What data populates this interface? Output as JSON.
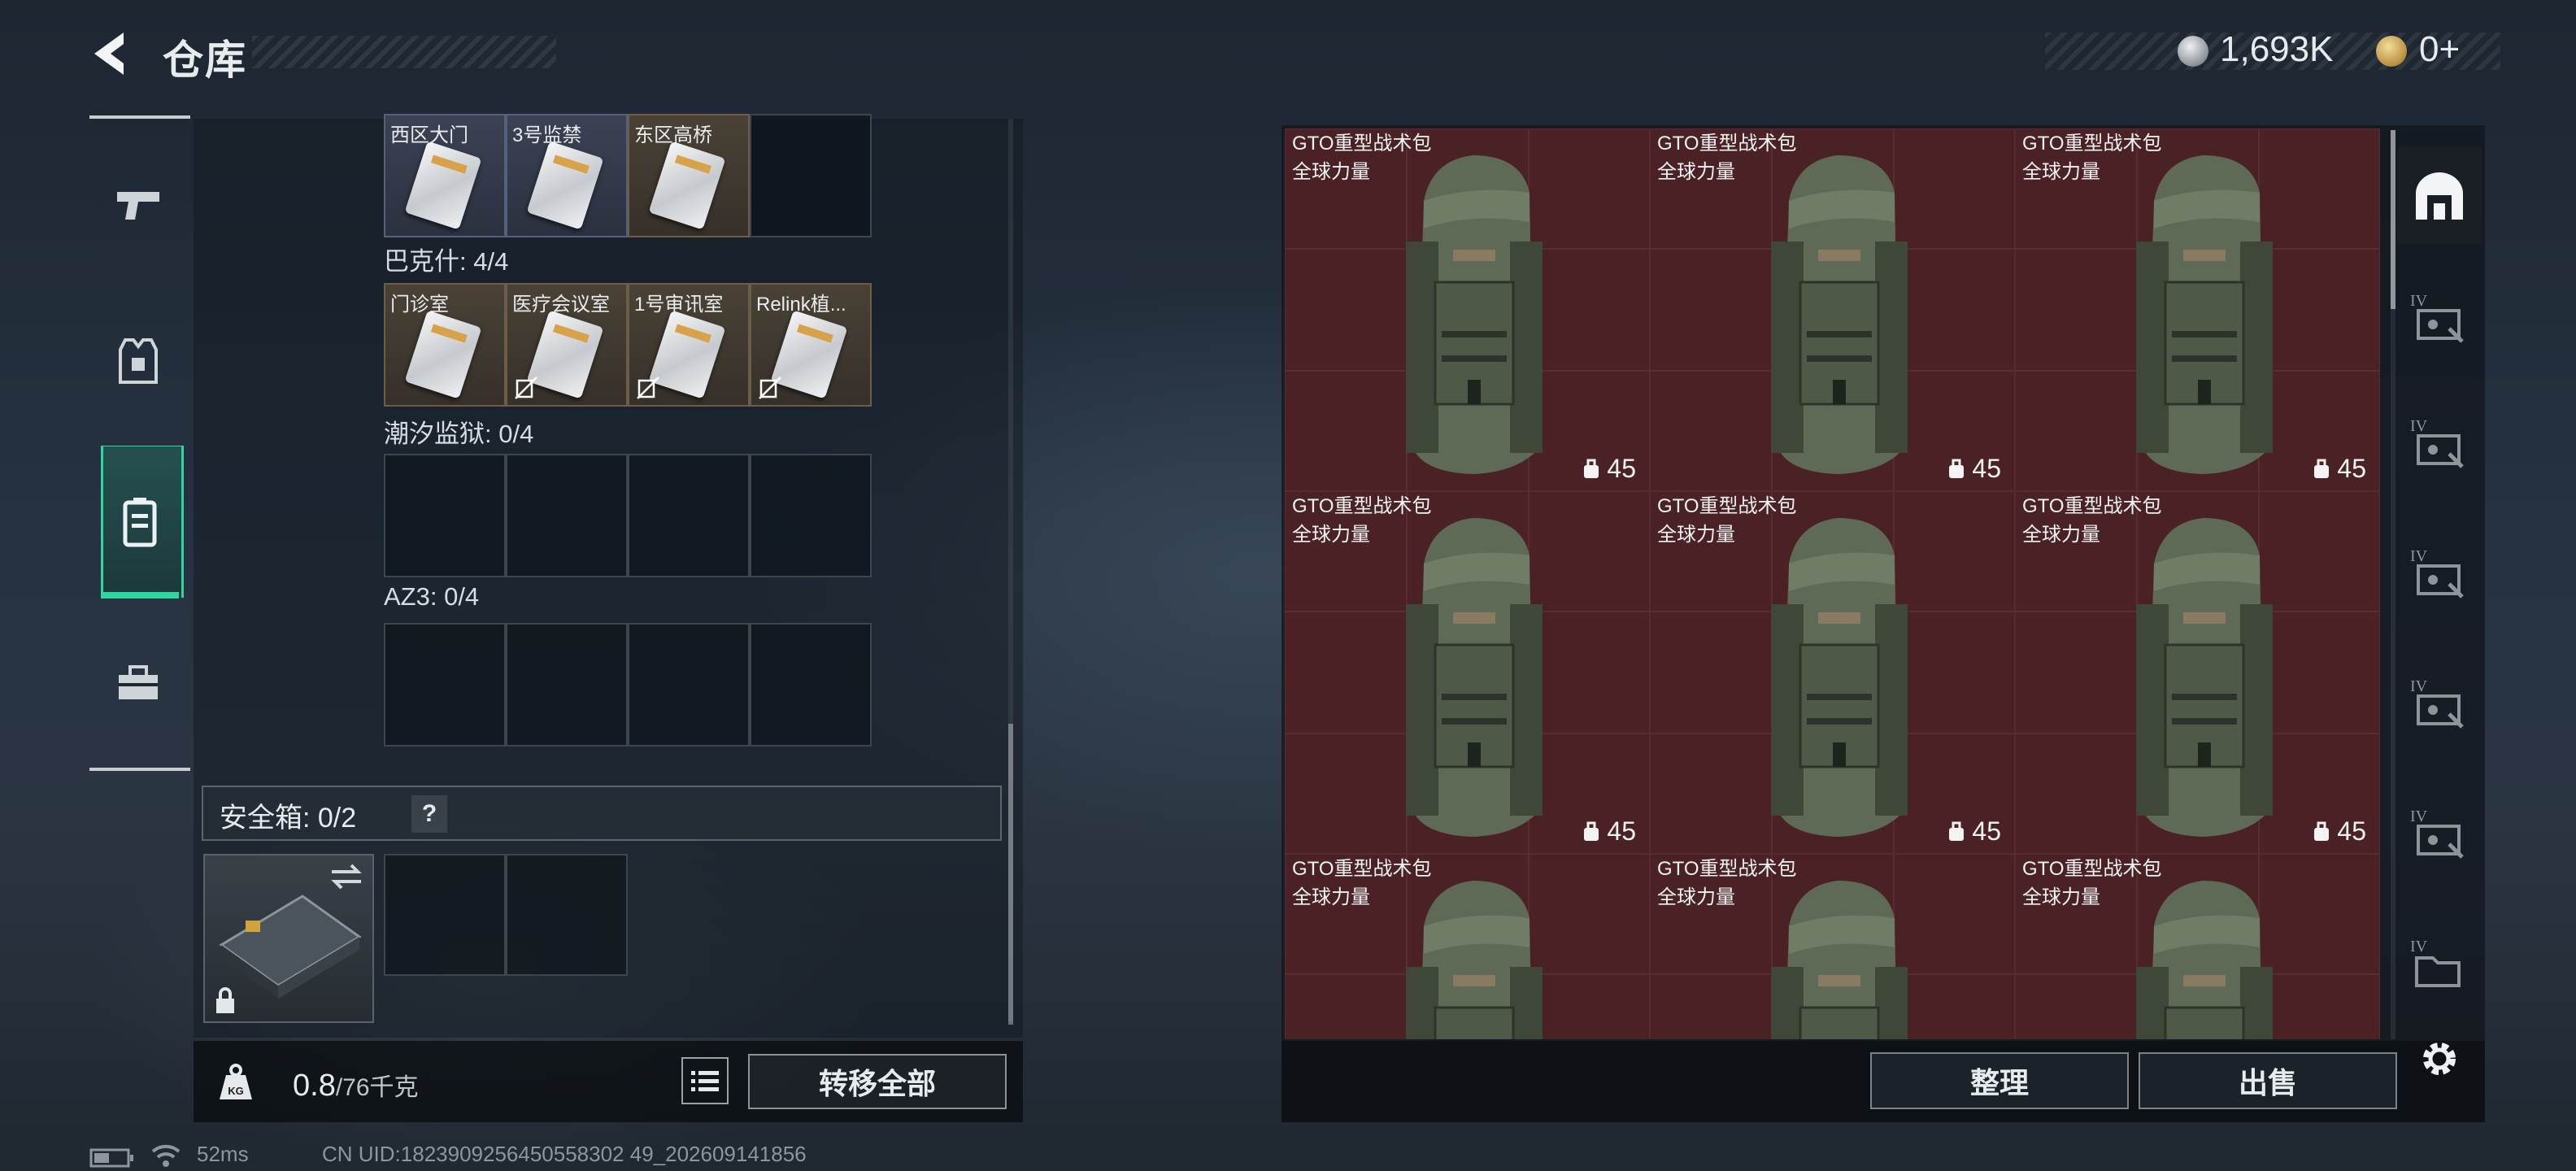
{
  "header": {
    "title": "仓库"
  },
  "currency": {
    "silver": "1,693K",
    "gold": "0+"
  },
  "nav": {
    "items": [
      "weapon",
      "gear",
      "backpack",
      "toolbox"
    ],
    "active": "backpack"
  },
  "key_sections": [
    {
      "label": "",
      "slots": [
        "西区大门",
        "3号监禁",
        "东区高桥",
        ""
      ]
    },
    {
      "label": "巴克什: 4/4",
      "slots": [
        "门诊室",
        "医疗会议室",
        "1号审讯室",
        "Relink植..."
      ]
    },
    {
      "label": "潮汐监狱: 0/4",
      "slots": [
        "",
        "",
        "",
        ""
      ]
    },
    {
      "label": "AZ3: 0/4",
      "slots": [
        "",
        "",
        "",
        ""
      ]
    }
  ],
  "safebox": {
    "label": "安全箱:  0/2",
    "help": "?"
  },
  "weight": {
    "current": "0.8",
    "max": "/76千克"
  },
  "buttons": {
    "transfer_all": "转移全部",
    "organize": "整理",
    "sell": "出售"
  },
  "items": [
    {
      "name": "GTO重型战术包",
      "brand": "全球力量",
      "capacity": "45"
    },
    {
      "name": "GTO重型战术包",
      "brand": "全球力量",
      "capacity": "45"
    },
    {
      "name": "GTO重型战术包",
      "brand": "全球力量",
      "capacity": "45"
    },
    {
      "name": "GTO重型战术包",
      "brand": "全球力量",
      "capacity": "45"
    },
    {
      "name": "GTO重型战术包",
      "brand": "全球力量",
      "capacity": "45"
    },
    {
      "name": "GTO重型战术包",
      "brand": "全球力量",
      "capacity": "45"
    },
    {
      "name": "GTO重型战术包",
      "brand": "全球力量",
      "capacity": ""
    },
    {
      "name": "GTO重型战术包",
      "brand": "全球力量",
      "capacity": ""
    },
    {
      "name": "GTO重型战术包",
      "brand": "全球力量",
      "capacity": ""
    }
  ],
  "side_tabs": [
    "all",
    "IV",
    "IV",
    "IV",
    "IV",
    "IV",
    "IV"
  ],
  "status": {
    "ping": "52ms",
    "uid": "CN UID:1823909256450558302 49_202609141856"
  }
}
